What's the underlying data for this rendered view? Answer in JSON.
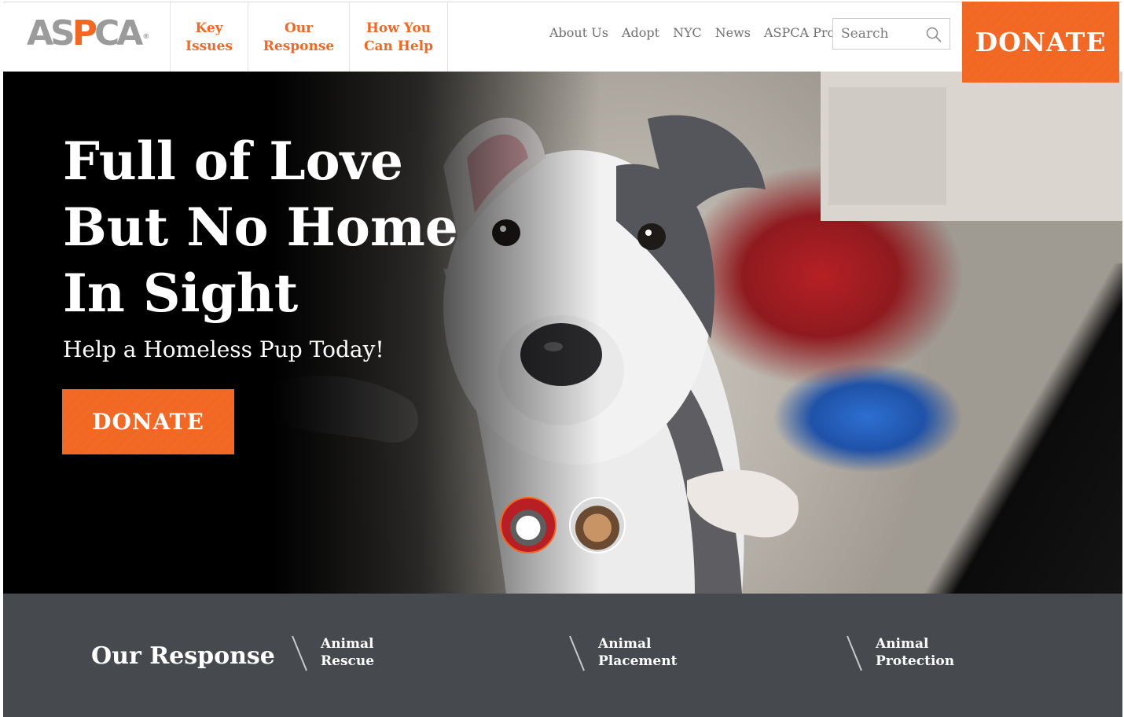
{
  "header": {
    "logo": {
      "text_pre": "AS",
      "text_p": "P",
      "text_post": "CA",
      "reg": "®"
    },
    "main_nav": [
      {
        "label": "Key\nIssues"
      },
      {
        "label": "Our\nResponse"
      },
      {
        "label": "How You\nCan Help"
      }
    ],
    "util_nav": [
      {
        "label": "About Us"
      },
      {
        "label": "Adopt"
      },
      {
        "label": "NYC"
      },
      {
        "label": "News"
      },
      {
        "label": "ASPCA Pro"
      }
    ],
    "search": {
      "placeholder": "Search",
      "icon": "search-icon"
    },
    "donate_label": "DONATE"
  },
  "hero": {
    "title": "Full of Love\nBut No Home\nIn Sight",
    "subtitle": "Help a Homeless Pup Today!",
    "donate_label": "DONATE",
    "slides": [
      {
        "name": "slide-thumb-pitbull",
        "active": true
      },
      {
        "name": "slide-thumb-puppy-fence",
        "active": false
      }
    ]
  },
  "response": {
    "heading": "Our Response",
    "links": [
      {
        "label": "Animal\nRescue"
      },
      {
        "label": "Animal\nPlacement"
      },
      {
        "label": "Animal\nProtection"
      }
    ]
  },
  "colors": {
    "brand_orange": "#f26722",
    "logo_gray": "#9b9b9b",
    "bar_gray": "#464a4e"
  }
}
